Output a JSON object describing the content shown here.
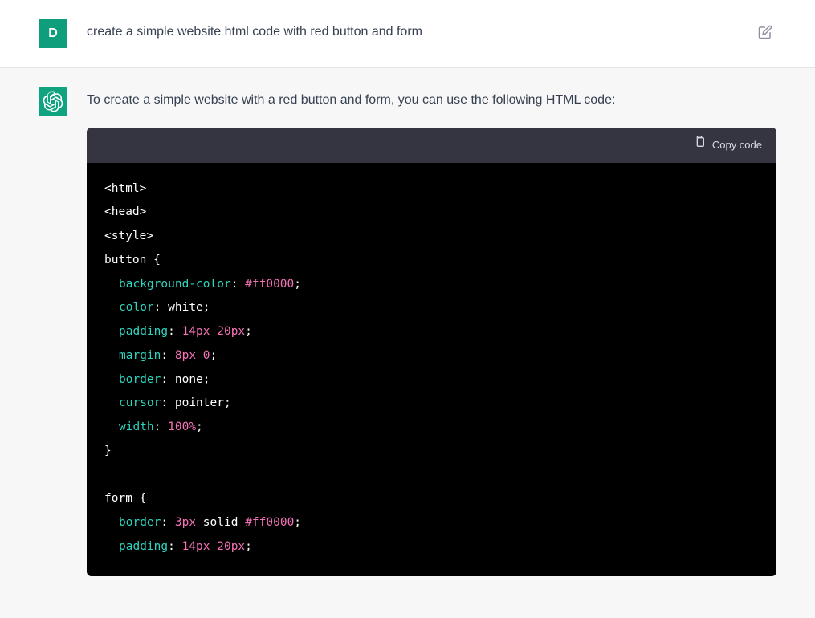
{
  "user": {
    "avatar_letter": "D",
    "prompt": "create a simple website html code with red button and form"
  },
  "assistant": {
    "intro": "To create a simple website with a red button and form, you can use the following HTML code:",
    "copy_label": "Copy code",
    "code": {
      "l1": "<html>",
      "l2": "<head>",
      "l3": "<style>",
      "l4_sel": "button {",
      "l5_prop": "background-color",
      "l5_val": "#ff0000",
      "l6_prop": "color",
      "l6_val": "white",
      "l7_prop": "padding",
      "l7_val_a": "14px",
      "l7_val_b": "20px",
      "l8_prop": "margin",
      "l8_val_a": "8px",
      "l8_val_b": "0",
      "l9_prop": "border",
      "l9_val": "none",
      "l10_prop": "cursor",
      "l10_val": "pointer",
      "l11_prop": "width",
      "l11_val": "100%",
      "l12": "}",
      "l14_sel": "form {",
      "l15_prop": "border",
      "l15_val_a": "3px",
      "l15_val_b": "solid",
      "l15_val_c": "#ff0000",
      "l16_prop": "padding",
      "l16_val_a": "14px",
      "l16_val_b": "20px"
    }
  }
}
